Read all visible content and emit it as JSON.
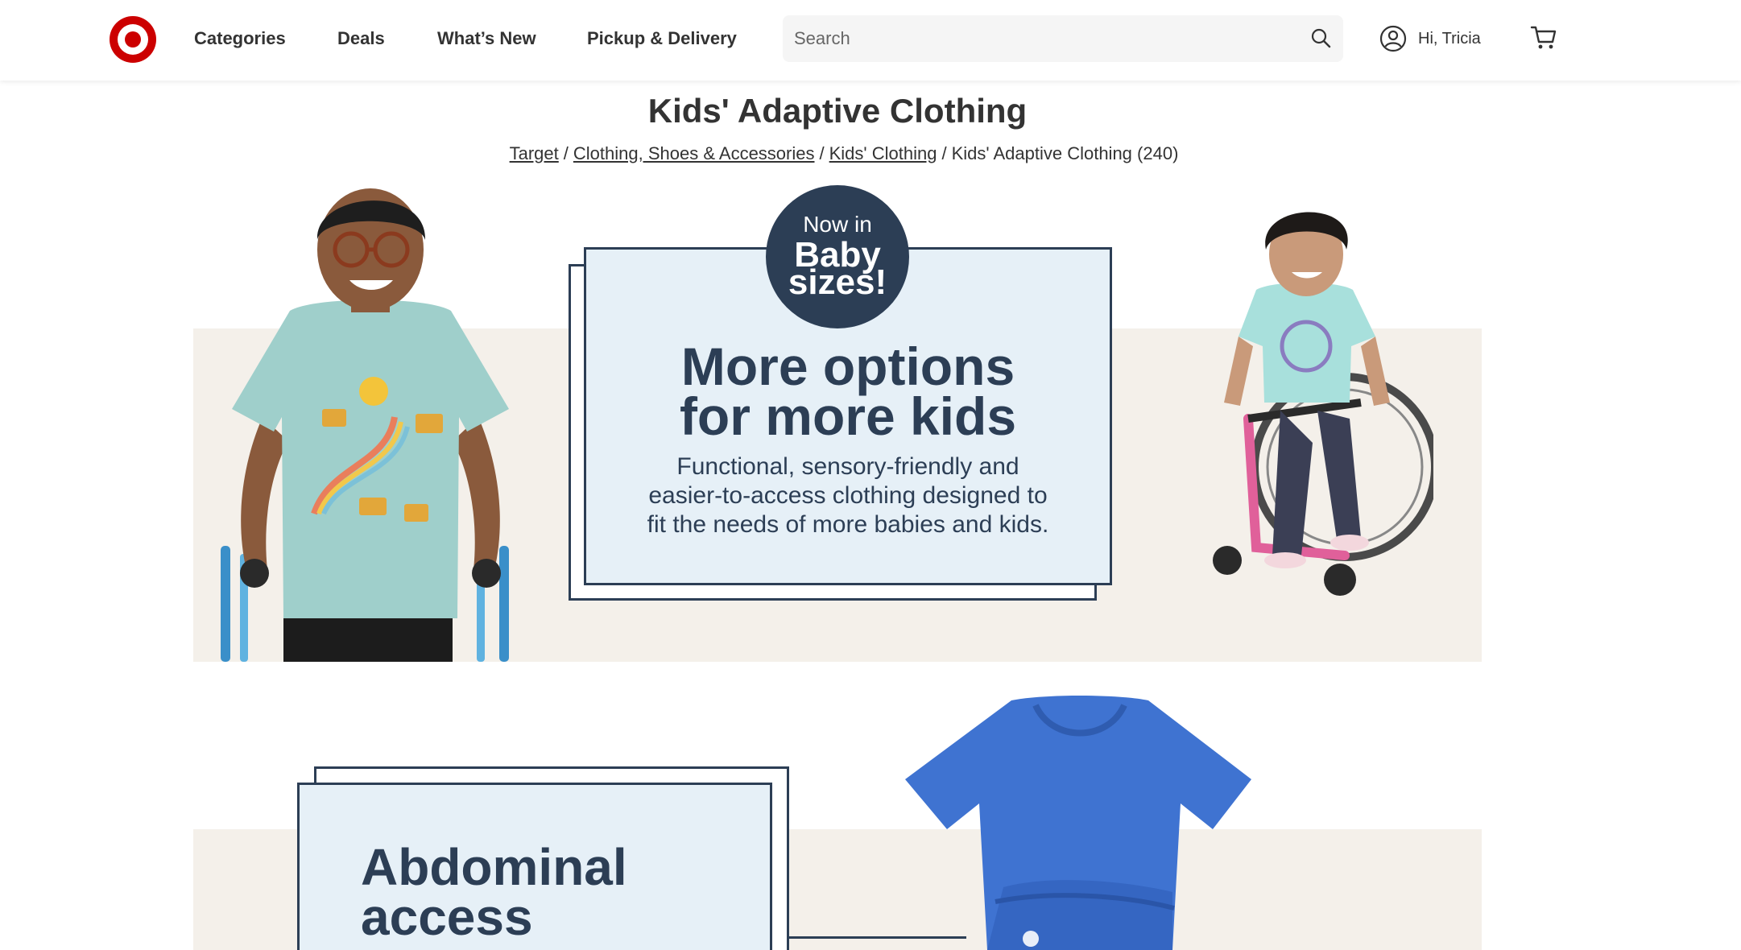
{
  "header": {
    "nav": [
      {
        "label": "Categories"
      },
      {
        "label": "Deals"
      },
      {
        "label": "What’s New"
      },
      {
        "label": "Pickup & Delivery"
      }
    ],
    "search": {
      "placeholder": "Search",
      "value": ""
    },
    "account_label": "Hi, Tricia",
    "icons": {
      "logo": "target-bullseye-logo",
      "search": "search-icon",
      "account": "account-circle-icon",
      "cart": "cart-icon"
    }
  },
  "page": {
    "title": "Kids' Adaptive Clothing",
    "breadcrumb": {
      "links": [
        "Target",
        "Clothing, Shoes & Accessories",
        "Kids' Clothing"
      ],
      "current": "Kids' Adaptive Clothing (240)"
    }
  },
  "hero": {
    "badge": {
      "line1": "Now in",
      "line2": "Baby",
      "line3": "sizes!"
    },
    "headline_line1": "More options",
    "headline_line2": "for more kids",
    "body_line1": "Functional, sensory-friendly and",
    "body_line2": "easier-to-access clothing designed to",
    "body_line3": "fit the needs of more babies and kids."
  },
  "hero2": {
    "headline_line1": "Abdominal",
    "headline_line2": "access"
  },
  "colors": {
    "brand_red": "#cc0000",
    "navy": "#2c3e55",
    "card_blue": "#e6f0f7",
    "beige": "#f4f0ea"
  }
}
